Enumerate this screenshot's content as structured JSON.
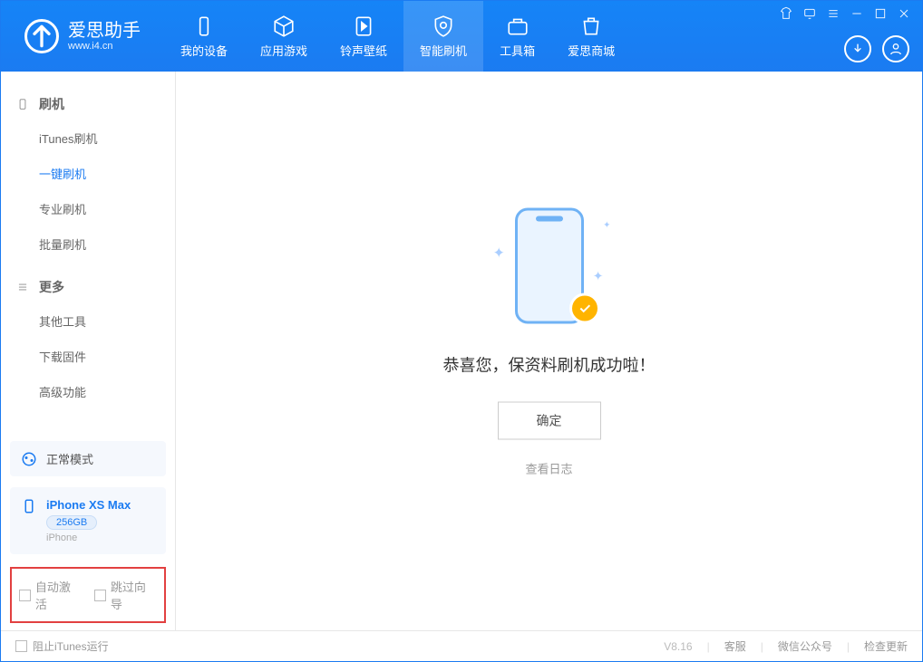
{
  "app": {
    "title": "爱思助手",
    "subtitle": "www.i4.cn"
  },
  "tabs": [
    {
      "id": "my-device",
      "label": "我的设备"
    },
    {
      "id": "apps-games",
      "label": "应用游戏"
    },
    {
      "id": "ringtones",
      "label": "铃声壁纸"
    },
    {
      "id": "smart-flash",
      "label": "智能刷机"
    },
    {
      "id": "toolbox",
      "label": "工具箱"
    },
    {
      "id": "store",
      "label": "爱思商城"
    }
  ],
  "sidebar": {
    "groups": [
      {
        "id": "flash",
        "title": "刷机",
        "items": [
          {
            "id": "itunes-flash",
            "label": "iTunes刷机"
          },
          {
            "id": "one-click-flash",
            "label": "一键刷机"
          },
          {
            "id": "pro-flash",
            "label": "专业刷机"
          },
          {
            "id": "batch-flash",
            "label": "批量刷机"
          }
        ]
      },
      {
        "id": "more",
        "title": "更多",
        "items": [
          {
            "id": "other-tools",
            "label": "其他工具"
          },
          {
            "id": "download-firmware",
            "label": "下载固件"
          },
          {
            "id": "advanced",
            "label": "高级功能"
          }
        ]
      }
    ]
  },
  "mode": {
    "label": "正常模式"
  },
  "device": {
    "name": "iPhone XS Max",
    "storage": "256GB",
    "type": "iPhone"
  },
  "options": {
    "auto_activate": "自动激活",
    "skip_guide": "跳过向导"
  },
  "main": {
    "success_text": "恭喜您，保资料刷机成功啦！",
    "ok_label": "确定",
    "view_log": "查看日志"
  },
  "footer": {
    "block_itunes": "阻止iTunes运行",
    "version": "V8.16",
    "links": {
      "support": "客服",
      "wechat": "微信公众号",
      "update": "检查更新"
    }
  }
}
